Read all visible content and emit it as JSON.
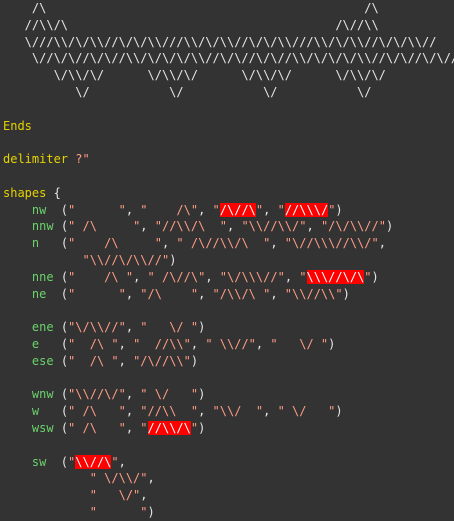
{
  "art_lines": [
    "    /\\                                            /\\",
    "   //\\\\/\\                                     /\\//\\\\",
    "   \\///\\\\/\\/\\\\//\\/\\/\\\\///\\\\/\\/\\\\//\\/\\/\\\\///\\\\/\\/\\\\//\\/\\/\\\\//",
    "    \\//\\/\\//\\/\\//\\\\/\\/\\/\\/\\\\//\\/\\//\\/\\//\\\\/\\/\\/\\/\\\\//\\/\\//\\/\\//",
    "       \\/\\\\/\\/      \\/\\\\/\\/      \\/\\\\/\\/      \\/\\\\/\\/",
    "          \\/           \\/           \\/           \\/"
  ],
  "ends_kw": "Ends",
  "delimiter_kw": "delimiter",
  "delimiter_val": "?\"",
  "shapes_kw": "shapes",
  "open_brace": " {",
  "rows": [
    {
      "dir": "nw",
      "parts": [
        [
          "p",
          "  ("
        ],
        [
          "s",
          "\"      \""
        ],
        [
          "p",
          ", "
        ],
        [
          "s",
          "\"    /\\\""
        ],
        [
          "p",
          ", "
        ],
        [
          "s",
          "\""
        ],
        [
          "h",
          "/\\//\\"
        ],
        [
          "s",
          "\""
        ],
        [
          "p",
          ", "
        ],
        [
          "s",
          "\""
        ],
        [
          "h",
          "//\\\\\\/"
        ],
        [
          "s",
          "\""
        ],
        [
          "p",
          ")"
        ]
      ]
    },
    {
      "dir": "nnw",
      "parts": [
        [
          "p",
          " ("
        ],
        [
          "s",
          "\" /\\     \""
        ],
        [
          "p",
          ", "
        ],
        [
          "s",
          "\"//\\\\/\\  \""
        ],
        [
          "p",
          ", "
        ],
        [
          "s",
          "\"\\\\//\\\\/\""
        ],
        [
          "p",
          ", "
        ],
        [
          "s",
          "\"/\\/\\\\//\""
        ],
        [
          "p",
          ")"
        ]
      ]
    },
    {
      "dir": "n",
      "parts": [
        [
          "p",
          "   ("
        ],
        [
          "s",
          "\"    /\\     \""
        ],
        [
          "p",
          ", "
        ],
        [
          "s",
          "\" /\\//\\\\/\\  \""
        ],
        [
          "p",
          ", "
        ],
        [
          "s",
          "\"\\//\\\\\\//\\\\/\""
        ],
        [
          "p",
          ","
        ]
      ]
    },
    {
      "dir": "",
      "parts": [
        [
          "p",
          "       "
        ],
        [
          "s",
          "\"\\\\//\\/\\\\//\""
        ],
        [
          "p",
          ")"
        ]
      ]
    },
    {
      "dir": "nne",
      "parts": [
        [
          "p",
          " ("
        ],
        [
          "s",
          "\"    /\\ \""
        ],
        [
          "p",
          ", "
        ],
        [
          "s",
          "\" /\\//\\\""
        ],
        [
          "p",
          ", "
        ],
        [
          "s",
          "\"\\/\\\\\\//\""
        ],
        [
          "p",
          ", "
        ],
        [
          "s",
          "\""
        ],
        [
          "h",
          "\\\\\\//\\/\\"
        ],
        [
          "s",
          "\""
        ],
        [
          "p",
          ")"
        ]
      ]
    },
    {
      "dir": "ne",
      "parts": [
        [
          "p",
          "  ("
        ],
        [
          "s",
          "\"      \""
        ],
        [
          "p",
          ", "
        ],
        [
          "s",
          "\"/\\    \""
        ],
        [
          "p",
          ", "
        ],
        [
          "s",
          "\"/\\\\/\\ \""
        ],
        [
          "p",
          ", "
        ],
        [
          "s",
          "\"\\\\//\\\\\""
        ],
        [
          "p",
          ")"
        ]
      ]
    },
    {
      "dir": "",
      "parts": []
    },
    {
      "dir": "ene",
      "parts": [
        [
          "p",
          " ("
        ],
        [
          "s",
          "\"\\/\\\\//\""
        ],
        [
          "p",
          ", "
        ],
        [
          "s",
          "\"   \\/ \""
        ],
        [
          "p",
          ")"
        ]
      ]
    },
    {
      "dir": "e",
      "parts": [
        [
          "p",
          "   ("
        ],
        [
          "s",
          "\"  /\\ \""
        ],
        [
          "p",
          ", "
        ],
        [
          "s",
          "\"  //\\\\\""
        ],
        [
          "p",
          ", "
        ],
        [
          "s",
          "\" \\\\//\""
        ],
        [
          "p",
          ", "
        ],
        [
          "s",
          "\"   \\/ \""
        ],
        [
          "p",
          ")"
        ]
      ]
    },
    {
      "dir": "ese",
      "parts": [
        [
          "p",
          " ("
        ],
        [
          "s",
          "\"  /\\ \""
        ],
        [
          "p",
          ", "
        ],
        [
          "s",
          "\"/\\//\\\\\""
        ],
        [
          "p",
          ")"
        ]
      ]
    },
    {
      "dir": "",
      "parts": []
    },
    {
      "dir": "wnw",
      "parts": [
        [
          "p",
          " ("
        ],
        [
          "s",
          "\"\\\\//\\/\""
        ],
        [
          "p",
          ", "
        ],
        [
          "s",
          "\" \\/   \""
        ],
        [
          "p",
          ")"
        ]
      ]
    },
    {
      "dir": "w",
      "parts": [
        [
          "p",
          "   ("
        ],
        [
          "s",
          "\" /\\   \""
        ],
        [
          "p",
          ", "
        ],
        [
          "s",
          "\"//\\\\  \""
        ],
        [
          "p",
          ", "
        ],
        [
          "s",
          "\"\\\\/  \""
        ],
        [
          "p",
          ", "
        ],
        [
          "s",
          "\" \\/   \""
        ],
        [
          "p",
          ")"
        ]
      ]
    },
    {
      "dir": "wsw",
      "parts": [
        [
          "p",
          " ("
        ],
        [
          "s",
          "\" /\\   \""
        ],
        [
          "p",
          ", "
        ],
        [
          "s",
          "\""
        ],
        [
          "h",
          "//\\\\/\\"
        ],
        [
          "s",
          "\""
        ],
        [
          "p",
          ")"
        ]
      ]
    },
    {
      "dir": "",
      "parts": []
    },
    {
      "dir": "sw",
      "parts": [
        [
          "p",
          "  ("
        ],
        [
          "s",
          "\""
        ],
        [
          "h",
          "\\\\//\\"
        ],
        [
          "s",
          "\""
        ],
        [
          "p",
          ","
        ]
      ]
    },
    {
      "dir": "",
      "parts": [
        [
          "p",
          "        "
        ],
        [
          "s",
          "\" \\/\\\\/\""
        ],
        [
          "p",
          ","
        ]
      ]
    },
    {
      "dir": "",
      "parts": [
        [
          "p",
          "        "
        ],
        [
          "s",
          "\"   \\/\""
        ],
        [
          "p",
          ","
        ]
      ]
    },
    {
      "dir": "",
      "parts": [
        [
          "p",
          "        "
        ],
        [
          "s",
          "\"      \""
        ],
        [
          "p",
          ")"
        ]
      ]
    }
  ],
  "colors": {
    "background": "#333333",
    "keyword": "#e6d300",
    "string": "#ff9d86",
    "direction": "#6bd36b",
    "highlight": "#ff0000"
  }
}
